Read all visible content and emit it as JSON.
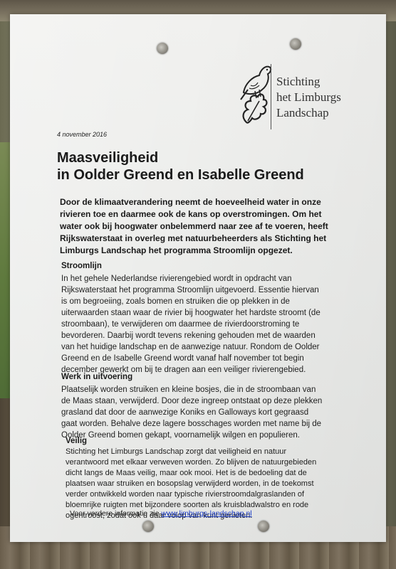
{
  "logo": {
    "lines": [
      "Stichting",
      "het Limburgs",
      "Landschap"
    ],
    "icon": "bird-on-oak-leaf-icon"
  },
  "date": "4 november 2016",
  "title_lines": [
    "Maasveiligheid",
    "in Oolder Greend en Isabelle Greend"
  ],
  "intro_lines": [
    "Door de klimaatverandering neemt de hoeveelheid water in onze",
    "rivieren toe en daarmee ook de kans op overstromingen. Om het",
    "water ook bij hoogwater onbelemmerd naar zee af te voeren, heeft",
    "Rijkswaterstaat in overleg met natuurbeheerders als Stichting het",
    "Limburgs Landschap het programma Stroomlijn opgezet."
  ],
  "sections": [
    {
      "heading": "Stroomlijn",
      "lines": [
        "In het gehele Nederlandse rivierengebied wordt in opdracht van",
        "Rijkswaterstaat het programma Stroomlijn uitgevoerd. Essentie hiervan",
        "is om begroeiing, zoals bomen en struiken die op plekken in de",
        "uiterwaarden staan waar de rivier bij hoogwater het hardste stroomt (de",
        "stroombaan), te verwijderen om daarmee de rivierdoorstroming te",
        "bevorderen. Daarbij wordt tevens rekening gehouden met de waarden",
        "van het huidige landschap en de aanwezige natuur. Rondom de Oolder",
        "Greend en de Isabelle Greend wordt vanaf half november tot begin",
        "december gewerkt om bij te dragen aan een veiliger rivierengebied."
      ]
    },
    {
      "heading": "Werk in uitvoering",
      "lines": [
        "Plaatselijk worden struiken en kleine bosjes, die in de stroombaan van",
        "de Maas staan, verwijderd. Door deze ingreep ontstaat op deze plekken",
        "grasland dat door de aanwezige Koniks en Galloways kort gegraasd",
        "gaat worden. Behalve deze lagere bosschages worden met name bij de",
        "Oolder Greend bomen gekapt, voornamelijk wilgen en populieren."
      ]
    },
    {
      "heading": "Veilig",
      "lines": [
        "Stichting het Limburgs Landschap zorgt dat veiligheid en natuur",
        "verantwoord met elkaar verweven worden. Zo blijven de natuurgebieden",
        "dicht langs de Maas veilig, maar ook mooi. Het is de bedoeling dat de",
        "plaatsen waar struiken en bosopslag verwijderd worden, in de toekomst",
        "verder ontwikkeld worden naar typische rivierstroomdalgraslanden of",
        "bloemrijke ruigten met bijzondere soorten als kruisbladwalstro en rode",
        "ogentroost, zodat ook u daar volop van kunt genieten."
      ]
    }
  ],
  "footer": {
    "text": "Voor verdere informatie zie ",
    "link": "www.limburgs-landschap.nl",
    "link_color": "#1a3cc8"
  }
}
